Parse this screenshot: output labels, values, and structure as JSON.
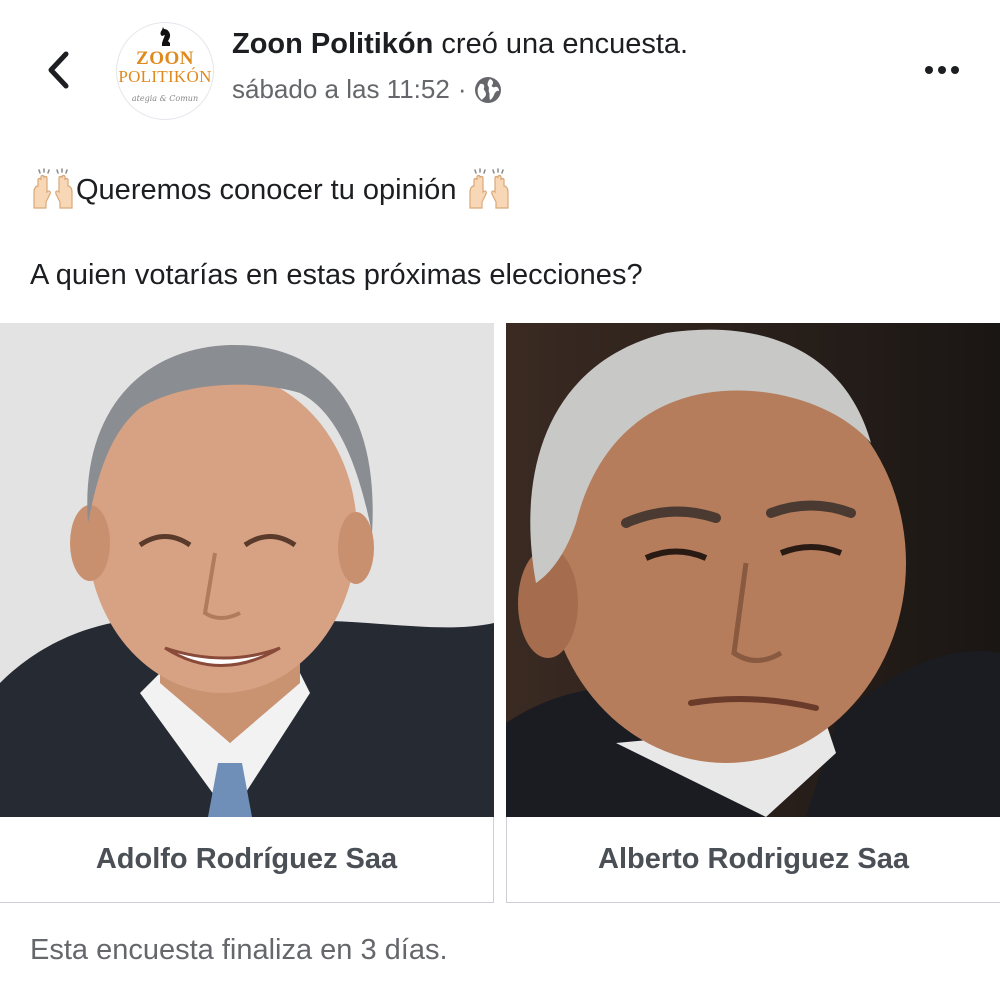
{
  "header": {
    "back_icon": "chevron-left-icon",
    "avatar": {
      "logo_top": "ZOON",
      "logo_mid": "POLITIKÓN",
      "logo_sub": "ategia & Comun"
    },
    "page_name": "Zoon Politikón",
    "action_text": "creó una encuesta.",
    "timestamp": "sábado a las 11:52",
    "separator": "·",
    "privacy_icon": "globe-icon",
    "more_icon": "more-horizontal-icon"
  },
  "post": {
    "line1_text": "Queremos conocer tu opinión",
    "emoji": "raised-hands-icon",
    "question": "A quien votarías en estas próximas elecciones?"
  },
  "poll": {
    "options": [
      {
        "label": "Adolfo Rodríguez Saa"
      },
      {
        "label": "Alberto Rodriguez Saa"
      }
    ],
    "footer": "Esta encuesta finaliza en 3 días."
  },
  "colors": {
    "text_primary": "#1c1e21",
    "text_secondary": "#65676b",
    "border": "#ccd0d5",
    "logo_orange": "#e08a1e"
  }
}
